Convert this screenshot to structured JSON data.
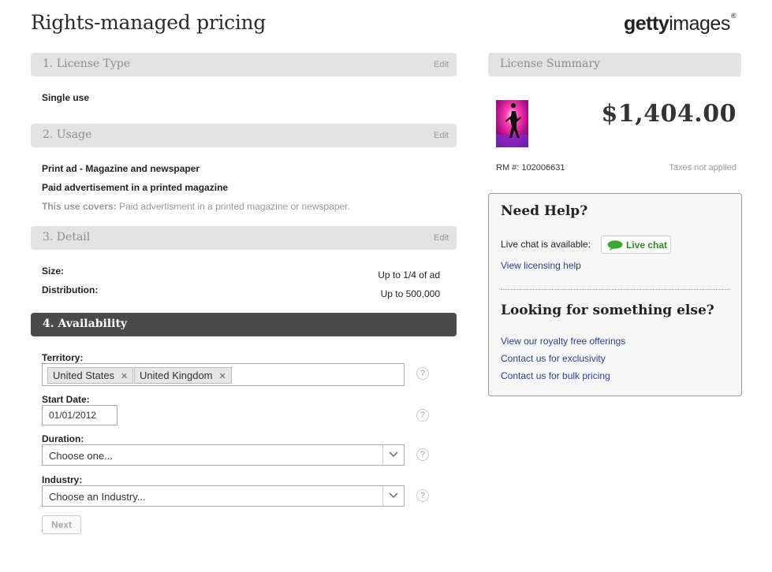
{
  "header": {
    "title": "Rights-managed pricing",
    "logo_bold": "getty",
    "logo_light": "images",
    "logo_mark": "®"
  },
  "sections": {
    "license_type": {
      "title": "1. License Type",
      "edit": "Edit",
      "value": "Single use"
    },
    "usage": {
      "title": "2. Usage",
      "edit": "Edit",
      "line1": "Print ad - Magazine and newspaper",
      "line2": "Paid advertisement in a printed magazine",
      "covers_label": "This use covers:",
      "covers_text": "Paid advertisment in a printed magazine or newspaper."
    },
    "detail": {
      "title": "3. Detail",
      "edit": "Edit",
      "size_label": "Size:",
      "size_value": "Up to 1/4 of ad",
      "distribution_label": "Distribution:",
      "distribution_value": "Up to 500,000"
    },
    "availability": {
      "title": "4. Availability",
      "territory_label": "Territory:",
      "territories": [
        "United States",
        "United Kingdom"
      ],
      "start_date_label": "Start Date:",
      "start_date_value": "01/01/2012",
      "duration_label": "Duration:",
      "duration_value": "Choose one...",
      "industry_label": "Industry:",
      "industry_value": "Choose an Industry...",
      "help_glyph": "?",
      "next_label": "Next"
    }
  },
  "summary": {
    "title": "License Summary",
    "price": "$1,404.00",
    "rm_number": "RM #: 102006631",
    "taxes": "Taxes not applied"
  },
  "help_panel": {
    "heading": "Need Help?",
    "live_chat_text": "Live chat is available:",
    "live_chat_button": "Live chat",
    "licensing_help_link": "View licensing help",
    "looking_heading": "Looking for something else?",
    "links": [
      "View our royalty free offerings",
      "Contact us for exclusivity",
      "Contact us for bulk pricing"
    ]
  },
  "colors": {
    "active_section_bg": "#4a4a4a",
    "section_bg": "#e3e3e3",
    "link": "#2a3f8f",
    "chat_green": "#2e8b1f"
  }
}
